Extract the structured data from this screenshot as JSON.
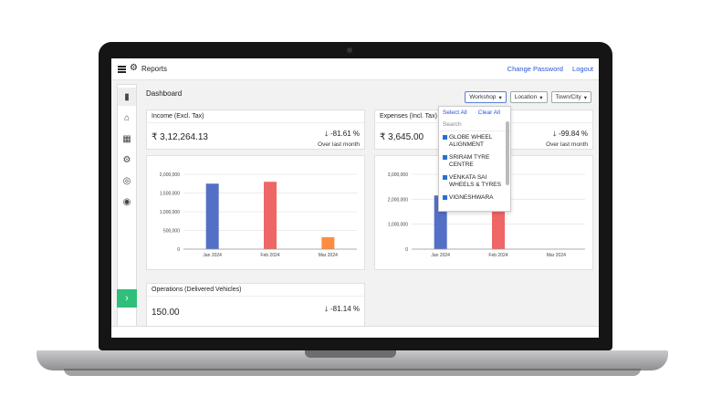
{
  "app": {
    "title": "Reports",
    "links": [
      "Change Password",
      "Logout"
    ]
  },
  "page": {
    "heading": "Dashboard"
  },
  "filters": [
    {
      "label": "Workshop",
      "active": true
    },
    {
      "label": "Location",
      "active": false
    },
    {
      "label": "Town/City",
      "active": false
    }
  ],
  "income": {
    "title": "Income (Excl. Tax)",
    "amount": "₹ 3,12,264.13",
    "delta": "-81.61 %",
    "note": "Over last month"
  },
  "expenses": {
    "title": "Expenses (Incl. Tax)",
    "amount": "₹ 3,645.00",
    "delta": "-99.84 %",
    "note": "Over last month"
  },
  "operations": {
    "title": "Operations (Delivered Vehicles)",
    "amount": "150.00",
    "delta": "-81.14 %"
  },
  "dropdown": {
    "select_all": "Select All",
    "clear_all": "Clear All",
    "search_placeholder": "Search",
    "items": [
      "GLOBE WHEEL ALIGNMENT",
      "SRIRAM TYRE CENTRE",
      "VENKATA SAI WHEELS & TYRES",
      "VIGNESHWARA"
    ]
  },
  "colors": {
    "blue": "#5470c6",
    "red": "#ee6666",
    "orange": "#fc8d40",
    "green": "#2fbf7a",
    "link": "#2a55d6"
  },
  "chart_data": [
    {
      "type": "bar",
      "categories": [
        "Jan 2024",
        "Feb 2024",
        "Mar 2024"
      ],
      "values": [
        1750000,
        1800000,
        320000
      ],
      "bar_colors": [
        "#5470c6",
        "#ee6666",
        "#fc8d40"
      ],
      "ylim": [
        0,
        2000000
      ],
      "yticks": [
        "0",
        "500,000",
        "1,000,000",
        "1,500,000",
        "2,000,000"
      ],
      "ytick_values": [
        0,
        500000,
        1000000,
        1500000,
        2000000
      ]
    },
    {
      "type": "bar",
      "categories": [
        "Jan 2024",
        "Feb 2024",
        "Mar 2024"
      ],
      "values": [
        2150000,
        1550000,
        0
      ],
      "bar_colors": [
        "#5470c6",
        "#ee6666",
        "#fc8d40"
      ],
      "ylim": [
        0,
        3000000
      ],
      "yticks": [
        "0",
        "1,000,000",
        "2,000,000",
        "3,000,000"
      ],
      "ytick_values": [
        0,
        1000000,
        2000000,
        3000000
      ]
    }
  ]
}
